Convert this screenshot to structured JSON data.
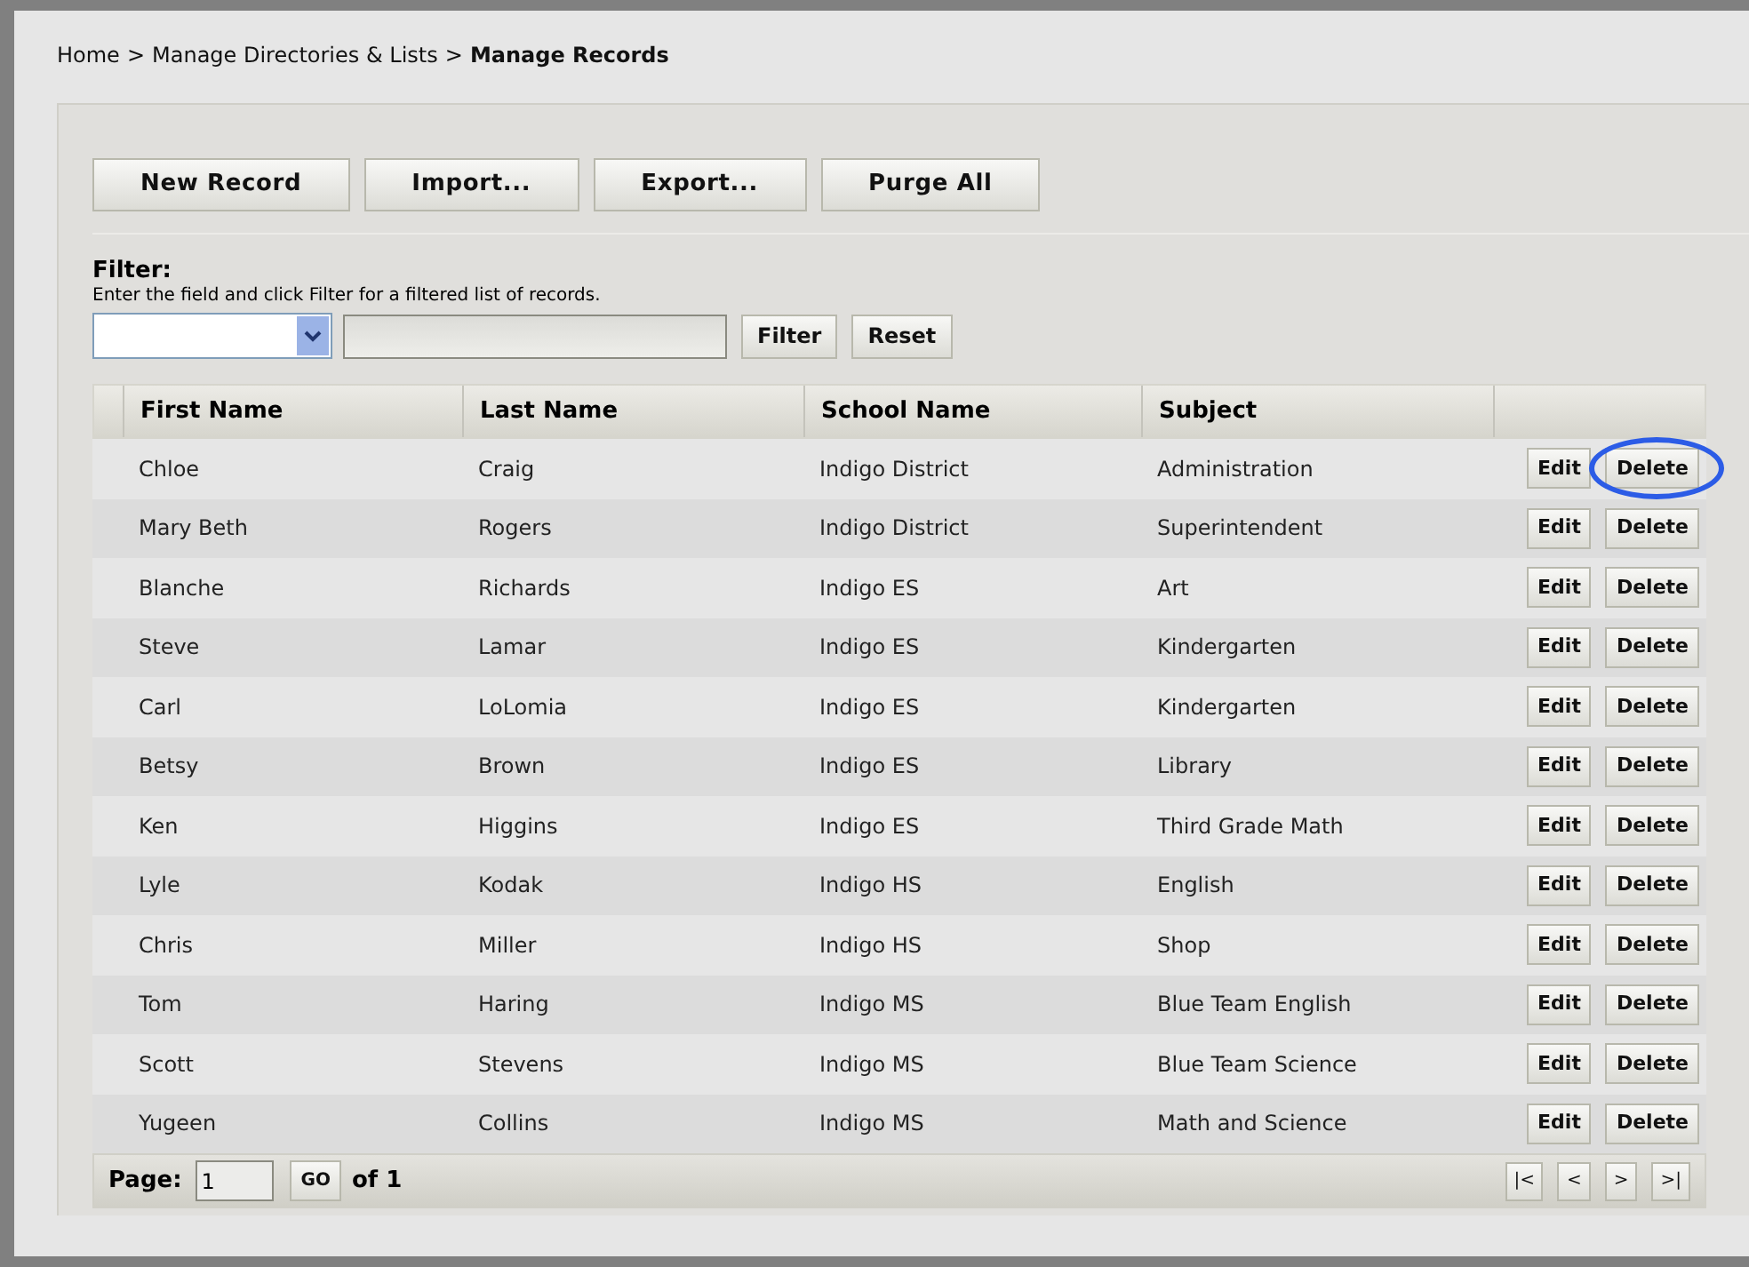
{
  "breadcrumb": {
    "links": [
      "Home",
      "Manage Directories & Lists"
    ],
    "separator": ">",
    "current": "Manage Records"
  },
  "toolbar": [
    "New Record",
    "Import...",
    "Export...",
    "Purge All"
  ],
  "filter": {
    "title": "Filter:",
    "hint": "Enter the field and click Filter for a filtered list of records.",
    "buttons": [
      "Filter",
      "Reset"
    ]
  },
  "table": {
    "columns": [
      "First Name",
      "Last Name",
      "School Name",
      "Subject"
    ],
    "rows": [
      {
        "cells": [
          "Chloe",
          "Craig",
          "Indigo District",
          "Administration"
        ],
        "actions": [
          "Edit",
          "Delete"
        ],
        "delete_circled": true
      },
      {
        "cells": [
          "Mary Beth",
          "Rogers",
          "Indigo District",
          "Superintendent"
        ],
        "actions": [
          "Edit",
          "Delete"
        ],
        "delete_circled": false
      },
      {
        "cells": [
          "Blanche",
          "Richards",
          "Indigo ES",
          "Art"
        ],
        "actions": [
          "Edit",
          "Delete"
        ],
        "delete_circled": false
      },
      {
        "cells": [
          "Steve",
          "Lamar",
          "Indigo ES",
          "Kindergarten"
        ],
        "actions": [
          "Edit",
          "Delete"
        ],
        "delete_circled": false
      },
      {
        "cells": [
          "Carl",
          "LoLomia",
          "Indigo ES",
          "Kindergarten"
        ],
        "actions": [
          "Edit",
          "Delete"
        ],
        "delete_circled": false
      },
      {
        "cells": [
          "Betsy",
          "Brown",
          "Indigo ES",
          "Library"
        ],
        "actions": [
          "Edit",
          "Delete"
        ],
        "delete_circled": false
      },
      {
        "cells": [
          "Ken",
          "Higgins",
          "Indigo ES",
          "Third Grade Math"
        ],
        "actions": [
          "Edit",
          "Delete"
        ],
        "delete_circled": false
      },
      {
        "cells": [
          "Lyle",
          "Kodak",
          "Indigo HS",
          "English"
        ],
        "actions": [
          "Edit",
          "Delete"
        ],
        "delete_circled": false
      },
      {
        "cells": [
          "Chris",
          "Miller",
          "Indigo HS",
          "Shop"
        ],
        "actions": [
          "Edit",
          "Delete"
        ],
        "delete_circled": false
      },
      {
        "cells": [
          "Tom",
          "Haring",
          "Indigo MS",
          "Blue Team English"
        ],
        "actions": [
          "Edit",
          "Delete"
        ],
        "delete_circled": false
      },
      {
        "cells": [
          "Scott",
          "Stevens",
          "Indigo MS",
          "Blue Team Science"
        ],
        "actions": [
          "Edit",
          "Delete"
        ],
        "delete_circled": false
      },
      {
        "cells": [
          "Yugeen",
          "Collins",
          "Indigo MS",
          "Math and Science"
        ],
        "actions": [
          "Edit",
          "Delete"
        ],
        "delete_circled": false
      }
    ]
  },
  "pager": {
    "label": "Page:",
    "value": "1",
    "go": "GO",
    "total": "of 1",
    "nav": [
      "|<",
      "<",
      ">",
      ">|"
    ]
  }
}
